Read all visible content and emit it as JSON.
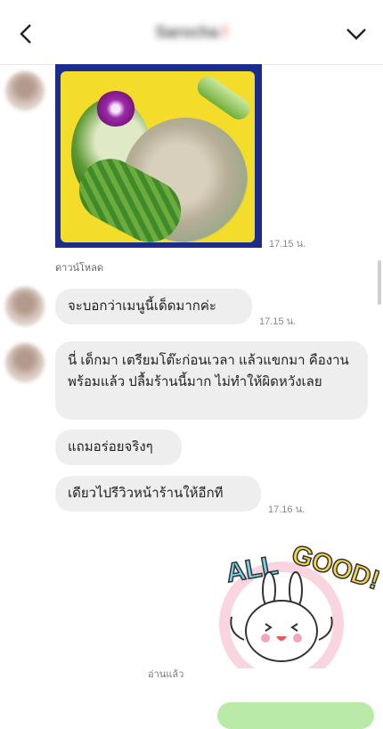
{
  "header": {
    "title": "Sarocha",
    "title_suffix": "!"
  },
  "messages": {
    "photo_time": "17.15 น.",
    "download_label": "ดาวน์โหลด",
    "msg1": {
      "text": "จะบอกว่าเมนูนี้เด็ดมากค่ะ",
      "time": "17.15 น."
    },
    "msg2": {
      "text": "นี่ เด็กมา เตรียมโต๊ะก่อนเวลา แล้วแขกมา คืองานพร้อมแล้ว ปลื้มร้านนี้มาก ไม่ทำให้ผิดหวังเลย"
    },
    "msg3": {
      "text": "แถมอร่อยจริงๆ"
    },
    "msg4": {
      "text": "เดียวไปรีวิวหน้าร้านให้อีกที",
      "time": "17.16 น."
    }
  },
  "sticker": {
    "text": "ALL GOOD!"
  },
  "read_status": "อ่านแล้ว",
  "icons": {
    "back": "chevron-left-icon",
    "menu": "chevron-down-icon"
  },
  "colors": {
    "bubble": "#eeeeee",
    "own_bubble": "#b9eaa8"
  }
}
